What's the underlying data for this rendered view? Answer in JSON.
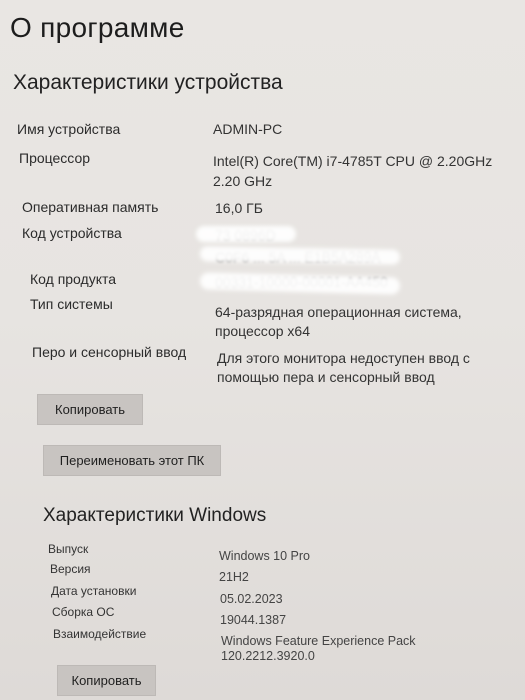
{
  "page_title": "О программе",
  "device": {
    "title": "Характеристики устройства",
    "rows": [
      {
        "label": "Имя устройства",
        "value": "ADMIN-PC"
      },
      {
        "label": "Процессор",
        "value": "Intel(R) Core(TM) i7-4785T CPU @ 2.20GHz",
        "value2": "2.20 GHz"
      },
      {
        "label": "Оперативная память",
        "value": "16,0 ГБ"
      },
      {
        "label": "Код устройства",
        "value": "73 0896D",
        "value2": "C0F6 ... 5A ... E1B5A289A"
      },
      {
        "label": "Код продукта",
        "value": "00331-10000-00001-AA450"
      },
      {
        "label": "Тип системы",
        "value": "64-разрядная операционная система,",
        "value2": "процессор x64"
      },
      {
        "label": "Перо и сенсорный ввод",
        "value": "Для этого монитора недоступен ввод с",
        "value2": "помощью пера и сенсорный ввод"
      }
    ],
    "copy_button": "Копировать",
    "rename_button": "Переименовать этот ПК"
  },
  "windows": {
    "title": "Характеристики Windows",
    "rows": [
      {
        "label": "Выпуск",
        "value": "Windows 10 Pro"
      },
      {
        "label": "Версия",
        "value": "21H2"
      },
      {
        "label": "Дата установки",
        "value": "05.02.2023"
      },
      {
        "label": "Сборка ОС",
        "value": "19044.1387"
      },
      {
        "label": "Взаимодействие",
        "value": "Windows Feature Experience Pack",
        "value2": "120.2212.3920.0"
      }
    ],
    "copy_button": "Копировать"
  }
}
